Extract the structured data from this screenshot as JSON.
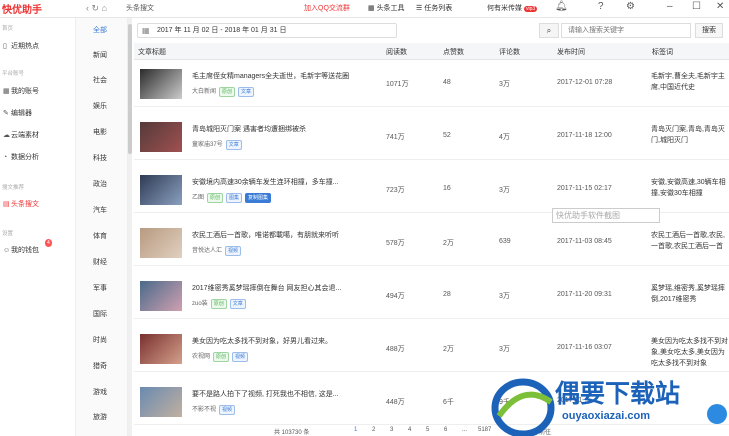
{
  "topbar": {
    "logo": "快优助手",
    "nav_icons": "‹ ↻ ⌂",
    "breadcrumb": "头条搜文",
    "qq_group": "加入QQ交流群",
    "tools": [
      "头条工具",
      "任务列表",
      "何有米传媒"
    ],
    "vip": "vip3"
  },
  "sidebar": {
    "section1": "首页",
    "recent": "近期热点",
    "section2": "平台账号",
    "items": [
      {
        "label": "我的账号",
        "icon": "grid-icon"
      },
      {
        "label": "编辑器",
        "icon": "edit-icon"
      },
      {
        "label": "云端素材",
        "icon": "cloud-icon"
      },
      {
        "label": "数据分析",
        "icon": "chart-icon"
      }
    ],
    "section3": "搜文推荐",
    "active_item": "头条搜文",
    "section4": "设置",
    "wallet": "我的钱包",
    "wallet_badge": "4"
  },
  "categories": [
    "全部",
    "新闻",
    "社会",
    "娱乐",
    "电影",
    "科技",
    "政治",
    "汽车",
    "体育",
    "财经",
    "军事",
    "国际",
    "时尚",
    "猎奇",
    "游戏",
    "旅游"
  ],
  "filter": {
    "date_range": "2017 年 11 月 02 日  -  2018 年 01 月 31 日",
    "search_placeholder": "请输入搜索关键字",
    "search_button": "搜索"
  },
  "table": {
    "headers": [
      "文章标题",
      "阅读数",
      "点赞数",
      "评论数",
      "发布时间",
      "标签词"
    ],
    "rows": [
      {
        "title": "毛主席侄女精managers全夫逝世，毛新宇等送花圈",
        "source": "大白新闻",
        "tags": [
          {
            "t": "原创",
            "k": "orig"
          },
          {
            "t": "文章",
            "k": "blue"
          }
        ],
        "reads": "1071万",
        "likes": "48",
        "comments": "3万",
        "time": "2017-12-01 07:28",
        "keywords": "毛新宇,曹全夫,毛新宇主席,中国近代史"
      },
      {
        "title": "青岛城阳灭门案 遇害者均遭捆绑被杀",
        "source": "童家庙37号",
        "tags": [
          {
            "t": "文章",
            "k": "blue"
          }
        ],
        "reads": "741万",
        "likes": "52",
        "comments": "4万",
        "time": "2017-11-18 12:00",
        "keywords": "青岛灭门案,青岛,青岛灭门,城阳灭门"
      },
      {
        "title": "安徽境内高速30余辆车发生连环相撞，多车撞...",
        "source": "乙图",
        "tags": [
          {
            "t": "原创",
            "k": "orig"
          },
          {
            "t": "图集",
            "k": "blue"
          },
          {
            "t": "复制图集",
            "k": "filled"
          }
        ],
        "reads": "723万",
        "likes": "16",
        "comments": "3万",
        "time": "2017-11-15 02:17",
        "keywords": "安徽,安徽高速,30辆车相撞,安徽30车相撞"
      },
      {
        "title": "农民工酒后一首歌，唯诺都載噶，有朋就来听听",
        "source": "音悦达人汇",
        "tags": [
          {
            "t": "视频",
            "k": "blue"
          }
        ],
        "reads": "578万",
        "likes": "2万",
        "comments": "639",
        "time": "2017-11-03 08:45",
        "keywords": "农民工酒后一首歌,农民,一首歌,农民工酒后一首"
      },
      {
        "title": "2017维密秀奚梦瑶摔倒在舞台 网友担心其会退...",
        "source": "zuo装",
        "tags": [
          {
            "t": "原创",
            "k": "orig"
          },
          {
            "t": "文章",
            "k": "blue"
          }
        ],
        "reads": "494万",
        "likes": "28",
        "comments": "3万",
        "time": "2017-11-20 09:31",
        "keywords": "奚梦瑶,维密秀,奚梦瑶摔倒,2017维密秀"
      },
      {
        "title": "美女因为吃太多找不到对象，好男儿看过来。",
        "source": "农视网",
        "tags": [
          {
            "t": "原创",
            "k": "orig"
          },
          {
            "t": "视频",
            "k": "blue"
          }
        ],
        "reads": "488万",
        "likes": "2万",
        "comments": "3万",
        "time": "2017-11-16 03:07",
        "keywords": "美女因为吃太多找不到对象,美女吃太多,美女因为吃太多找不到对象"
      },
      {
        "title": "要不是路人拍下了视频, 打死我也不相信, 这是...",
        "source": "不影不视",
        "tags": [
          {
            "t": "视频",
            "k": "blue"
          }
        ],
        "reads": "448万",
        "likes": "6千",
        "comments": "9千",
        "time": "2017-11-...",
        "keywords": ""
      }
    ]
  },
  "pager": {
    "total": "共 103730 条",
    "pages": [
      "1",
      "2",
      "3",
      "4",
      "5",
      "6",
      "...",
      "5187"
    ],
    "next": "前往"
  },
  "tooltip": "快优助手软件截图",
  "watermark": {
    "brand": "偶要下载站",
    "url": "ouyaoxiazai.com"
  }
}
